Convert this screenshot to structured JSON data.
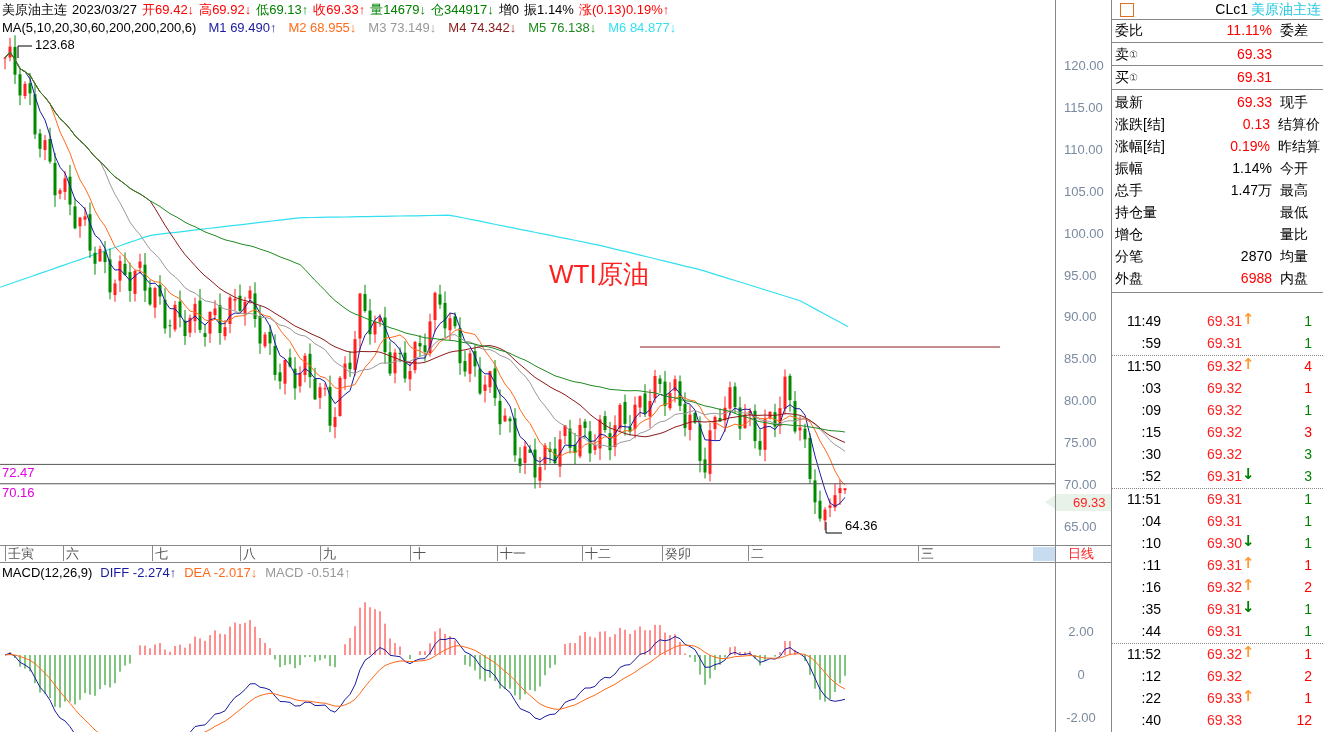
{
  "header": {
    "items": [
      {
        "text": "美原油主连"
      },
      {
        "text": "2023/03/27"
      },
      {
        "text": "开69.42↓",
        "color": "#ff0000"
      },
      {
        "text": "高69.92↓",
        "color": "#ff0000"
      },
      {
        "text": "低69.13↑",
        "color": "#008000"
      },
      {
        "text": "收69.33↑",
        "color": "#ff0000"
      },
      {
        "text": "量14679↓",
        "color": "#008000"
      },
      {
        "text": "仓344917↓",
        "color": "#008000"
      },
      {
        "text": "增0"
      },
      {
        "text": "振1.14%"
      },
      {
        "text": "涨(0.13)0.19%↑",
        "color": "#ff0000"
      }
    ],
    "ma_title": "MA(5,10,20,30,60,200,200,200,6)",
    "ma_items": [
      {
        "label": "M1",
        "value": "69.490↑",
        "color": "#1a1aa0"
      },
      {
        "label": "M2",
        "value": "68.955↓",
        "color": "#ff6a1a"
      },
      {
        "label": "M3",
        "value": "73.149↓",
        "color": "#999999"
      },
      {
        "label": "M4",
        "value": "74.342↓",
        "color": "#8b1a1a"
      },
      {
        "label": "M5",
        "value": "76.138↓",
        "color": "#1f8a1f"
      },
      {
        "label": "M6",
        "value": "84.877↓",
        "color": "#33e0f0"
      }
    ]
  },
  "price_chart": {
    "title": "WTI原油",
    "high_label": "123.68",
    "low_label": "64.36",
    "level_lines": [
      {
        "label": "72.47"
      },
      {
        "label": "70.16"
      }
    ],
    "last_price": "69.33",
    "yticks": [
      "120.00",
      "115.00",
      "110.00",
      "105.00",
      "100.00",
      "95.00",
      "90.00",
      "85.00",
      "80.00",
      "75.00",
      "70.00",
      "65.00"
    ]
  },
  "time_axis": {
    "labels": [
      "壬寅",
      "六",
      "七",
      "八",
      "九",
      "十",
      "十一",
      "十二",
      "癸卯",
      "二",
      "三"
    ],
    "period": "日线"
  },
  "macd": {
    "title": "MACD(12,26,9)",
    "items": [
      {
        "text": "DIFF -2.274↑",
        "color": "#1a1aa0"
      },
      {
        "text": "DEA -2.017↓",
        "color": "#ff6a1a"
      },
      {
        "text": "MACD -0.514↑",
        "color": "#999999"
      }
    ],
    "yticks": [
      "2.00",
      "0",
      "-2.00"
    ]
  },
  "quote": {
    "code": "CLc1",
    "name": "美原油主连",
    "ratio": {
      "label": "委比",
      "value": "11.11%",
      "color": "#ff0000",
      "label2": "委差"
    },
    "ask": {
      "label": "卖",
      "marker": "①",
      "value": "69.33",
      "color": "#ff0000"
    },
    "bid": {
      "label": "买",
      "marker": "①",
      "value": "69.31",
      "color": "#ff0000"
    },
    "rows": [
      {
        "label": "最新",
        "value": "69.33",
        "color": "#ff0000",
        "label2": "现手"
      },
      {
        "label": "涨跌[结]",
        "value": "0.13",
        "color": "#ff0000",
        "label2": "结算价"
      },
      {
        "label": "涨幅[结]",
        "value": "0.19%",
        "color": "#ff0000",
        "label2": "昨结算"
      },
      {
        "label": "振幅",
        "value": "1.14%",
        "label2": "今开"
      },
      {
        "label": "总手",
        "value": "1.47万",
        "label2": "最高"
      },
      {
        "label": "持仓量",
        "label2": "最低"
      },
      {
        "label": "增仓",
        "label2": "量比"
      },
      {
        "label": "分笔",
        "value": "2870",
        "label2": "均量"
      },
      {
        "label": "外盘",
        "value": "6988",
        "color": "#ff0000",
        "label2": "内盘"
      }
    ]
  },
  "trades": [
    {
      "trades": [
        {
          "time": "11:49",
          "price": "69.31",
          "arrow": {
            "text": "↑",
            "color": "#ff9933"
          },
          "volume": {
            "text": "1",
            "color": "#008000"
          }
        },
        {
          "time": ":59",
          "price": "69.31",
          "volume": {
            "text": "1",
            "color": "#008000"
          }
        }
      ]
    },
    {
      "trades": [
        {
          "time": "11:50",
          "price": "69.32",
          "arrow": {
            "text": "↑",
            "color": "#ff9933"
          },
          "volume": {
            "text": "4",
            "color": "#ff0000"
          }
        },
        {
          "time": ":03",
          "price": "69.32",
          "volume": {
            "text": "1",
            "color": "#ff0000"
          }
        },
        {
          "time": ":09",
          "price": "69.32",
          "volume": {
            "text": "1",
            "color": "#008000"
          }
        },
        {
          "time": ":15",
          "price": "69.32",
          "volume": {
            "text": "3",
            "color": "#ff0000"
          }
        },
        {
          "time": ":30",
          "price": "69.32",
          "volume": {
            "text": "3",
            "color": "#008000"
          }
        },
        {
          "time": ":52",
          "price": "69.31",
          "arrow": {
            "text": "↓",
            "color": "#008000"
          },
          "volume": {
            "text": "3",
            "color": "#008000"
          }
        }
      ]
    },
    {
      "trades": [
        {
          "time": "11:51",
          "price": "69.31",
          "volume": {
            "text": "1",
            "color": "#008000"
          }
        },
        {
          "time": ":04",
          "price": "69.31",
          "volume": {
            "text": "1",
            "color": "#008000"
          }
        },
        {
          "time": ":10",
          "price": "69.30",
          "arrow": {
            "text": "↓",
            "color": "#008000"
          },
          "volume": {
            "text": "1",
            "color": "#008000"
          }
        },
        {
          "time": ":11",
          "price": "69.31",
          "arrow": {
            "text": "↑",
            "color": "#ff9933"
          },
          "volume": {
            "text": "1",
            "color": "#ff0000"
          }
        },
        {
          "time": ":16",
          "price": "69.32",
          "arrow": {
            "text": "↑",
            "color": "#ff9933"
          },
          "volume": {
            "text": "2",
            "color": "#ff0000"
          }
        },
        {
          "time": ":35",
          "price": "69.31",
          "arrow": {
            "text": "↓",
            "color": "#008000"
          },
          "volume": {
            "text": "1",
            "color": "#008000"
          }
        },
        {
          "time": ":44",
          "price": "69.31",
          "volume": {
            "text": "1",
            "color": "#008000"
          }
        }
      ]
    },
    {
      "trades": [
        {
          "time": "11:52",
          "price": "69.32",
          "arrow": {
            "text": "↑",
            "color": "#ff9933"
          },
          "volume": {
            "text": "1",
            "color": "#ff0000"
          }
        },
        {
          "time": ":12",
          "price": "69.32",
          "volume": {
            "text": "2",
            "color": "#ff0000"
          }
        },
        {
          "time": ":22",
          "price": "69.33",
          "arrow": {
            "text": "↑",
            "color": "#ff9933"
          },
          "volume": {
            "text": "1",
            "color": "#ff0000"
          }
        },
        {
          "time": ":40",
          "price": "69.33",
          "volume": {
            "text": "12",
            "color": "#ff0000"
          }
        }
      ]
    }
  ]
}
